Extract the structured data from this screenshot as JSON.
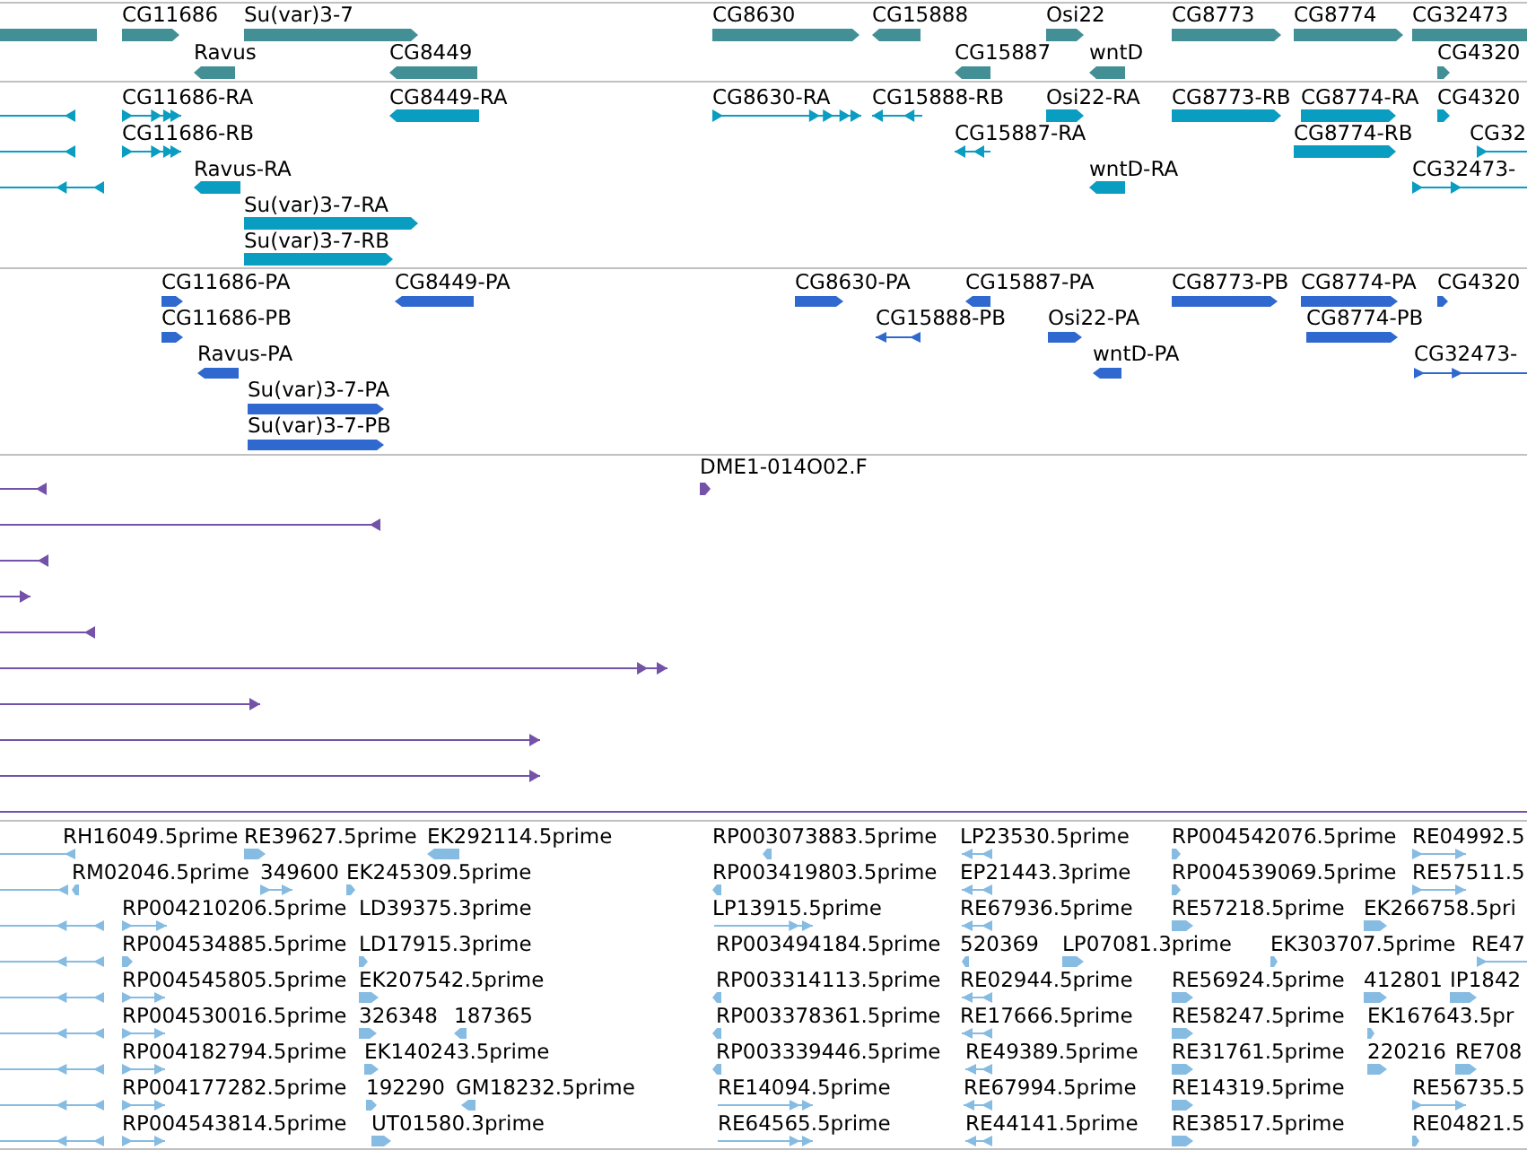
{
  "tracks": [
    {
      "color": "#428f96",
      "lanes": [
        {
          "features": [
            {
              "reverse": true
            },
            {
              "label": "CG11686",
              "reverse": false
            },
            {
              "label": "Su(var)3-7",
              "reverse": false
            },
            {
              "label": "CG8630",
              "reverse": false
            },
            {
              "label": "CG15888",
              "reverse": true
            },
            {
              "label": "Osi22",
              "reverse": false
            },
            {
              "label": "CG8773",
              "reverse": false
            },
            {
              "label": "CG8774",
              "reverse": false
            },
            {
              "label": "CG32473",
              "reverse": false
            }
          ]
        },
        {
          "features": [
            {
              "label": "Ravus",
              "reverse": true
            },
            {
              "label": "CG8449",
              "reverse": true
            },
            {
              "label": "CG15887",
              "reverse": true
            },
            {
              "label": "wntD",
              "reverse": true
            },
            {
              "label": "CG4320",
              "reverse": false
            }
          ]
        }
      ]
    },
    {
      "color": "#0a9dc2",
      "lanes": [
        {
          "features": [
            {
              "reverse": true
            },
            {
              "label": "CG11686-RA",
              "reverse": false
            },
            {
              "label": "CG8449-RA",
              "reverse": true
            },
            {
              "label": "CG8630-RA",
              "reverse": false
            },
            {
              "label": "CG15888-RB",
              "reverse": true
            },
            {
              "label": "Osi22-RA",
              "reverse": false
            },
            {
              "label": "CG8773-RB",
              "reverse": false
            },
            {
              "label": "CG8774-RA",
              "reverse": false
            },
            {
              "label": "CG4320",
              "reverse": false
            }
          ]
        },
        {
          "features": [
            {
              "reverse": true
            },
            {
              "label": "CG11686-RB",
              "reverse": false
            },
            {
              "label": "CG15887-RA",
              "reverse": true
            },
            {
              "label": "CG8774-RB",
              "reverse": false
            },
            {
              "label": "CG32",
              "reverse": false
            }
          ]
        },
        {
          "features": [
            {
              "reverse": true
            },
            {
              "label": "Ravus-RA",
              "reverse": true
            },
            {
              "label": "wntD-RA",
              "reverse": true
            },
            {
              "label": "CG32473-",
              "reverse": false
            }
          ]
        },
        {
          "features": [
            {
              "label": "Su(var)3-7-RA",
              "reverse": false
            }
          ]
        },
        {
          "features": [
            {
              "label": "Su(var)3-7-RB",
              "reverse": false
            }
          ]
        }
      ]
    },
    {
      "color": "#2f68cf",
      "lanes": [
        {
          "features": [
            {
              "label": "CG11686-PA",
              "reverse": false
            },
            {
              "label": "CG8449-PA",
              "reverse": true
            },
            {
              "label": "CG8630-PA",
              "reverse": false
            },
            {
              "label": "CG15887-PA",
              "reverse": true
            },
            {
              "label": "CG8773-PB",
              "reverse": false
            },
            {
              "label": "CG8774-PA",
              "reverse": false
            },
            {
              "label": "CG4320",
              "reverse": false
            }
          ]
        },
        {
          "features": [
            {
              "label": "CG11686-PB",
              "reverse": false
            },
            {
              "label": "CG15888-PB",
              "reverse": true
            },
            {
              "label": "Osi22-PA",
              "reverse": false
            },
            {
              "label": "CG8774-PB",
              "reverse": false
            }
          ]
        },
        {
          "features": [
            {
              "label": "Ravus-PA",
              "reverse": true
            },
            {
              "label": "wntD-PA",
              "reverse": true
            },
            {
              "label": "CG32473-",
              "reverse": false
            }
          ]
        },
        {
          "features": [
            {
              "label": "Su(var)3-7-PA",
              "reverse": false
            }
          ]
        },
        {
          "features": [
            {
              "label": "Su(var)3-7-PB",
              "reverse": false
            }
          ]
        }
      ]
    },
    {
      "color": "#7452a8",
      "lanes": [
        {
          "features": [
            {
              "reverse": true
            },
            {
              "label": "DME1-014O02.F",
              "reverse": false
            }
          ]
        },
        {
          "features": [
            {
              "reverse": true
            }
          ]
        },
        {
          "features": [
            {
              "reverse": true
            }
          ]
        },
        {
          "features": [
            {
              "reverse": false
            }
          ]
        },
        {
          "features": [
            {
              "reverse": true
            }
          ]
        },
        {
          "features": [
            {
              "reverse": false
            }
          ]
        },
        {
          "features": [
            {
              "reverse": false
            }
          ]
        },
        {
          "features": [
            {
              "reverse": false
            }
          ]
        },
        {
          "features": [
            {
              "reverse": false
            }
          ]
        }
      ]
    },
    {
      "color": "#86bbe2",
      "lanes": [
        {
          "features": [
            {
              "label": "RH16049.5prime",
              "reverse": true
            },
            {
              "label": "RE39627.5prime",
              "reverse": false
            },
            {
              "label": "EK292114.5prime",
              "reverse": true
            },
            {
              "label": "RP003073883.5prime",
              "reverse": true
            },
            {
              "label": "LP23530.5prime",
              "reverse": true
            },
            {
              "label": "RP004542076.5prime",
              "reverse": false
            },
            {
              "label": "RE04992.5",
              "reverse": false
            }
          ]
        },
        {
          "features": [
            {
              "reverse": true
            },
            {
              "label": "RM02046.5prime",
              "reverse": true
            },
            {
              "label": "349600",
              "reverse": false
            },
            {
              "label": "EK245309.5prime",
              "reverse": false
            },
            {
              "label": "RP003419803.5prime",
              "reverse": true
            },
            {
              "label": "EP21443.3prime",
              "reverse": true
            },
            {
              "label": "RP004539069.5prime",
              "reverse": false
            },
            {
              "label": "RE57511.5",
              "reverse": false
            }
          ]
        },
        {
          "features": [
            {
              "reverse": true
            },
            {
              "label": "RP004210206.5prime",
              "reverse": false
            },
            {
              "label": "LD39375.3prime"
            },
            {
              "label": "LP13915.5prime",
              "reverse": false
            },
            {
              "label": "RE67936.5prime",
              "reverse": true
            },
            {
              "label": "RE57218.5prime",
              "reverse": false
            },
            {
              "label": "EK266758.5pri",
              "reverse": false
            }
          ]
        },
        {
          "features": [
            {
              "reverse": true
            },
            {
              "label": "RP004534885.5prime",
              "reverse": false
            },
            {
              "label": "LD17915.3prime",
              "reverse": false
            },
            {
              "label": "RP003494184.5prime"
            },
            {
              "label": "520369",
              "reverse": true
            },
            {
              "label": "LP07081.3prime",
              "reverse": false
            },
            {
              "label": "EK303707.5prime",
              "reverse": false
            },
            {
              "label": "RE47",
              "reverse": false
            }
          ]
        },
        {
          "features": [
            {
              "reverse": true
            },
            {
              "label": "RP004545805.5prime",
              "reverse": false
            },
            {
              "label": "EK207542.5prime",
              "reverse": false
            },
            {
              "label": "RP003314113.5prime",
              "reverse": true
            },
            {
              "label": "RE02944.5prime",
              "reverse": true
            },
            {
              "label": "RE56924.5prime",
              "reverse": false
            },
            {
              "label": "412801",
              "reverse": false
            },
            {
              "label": "IP1842",
              "reverse": false
            }
          ]
        },
        {
          "features": [
            {
              "reverse": true
            },
            {
              "label": "RP004530016.5prime",
              "reverse": false
            },
            {
              "label": "326348",
              "reverse": false
            },
            {
              "label": "187365",
              "reverse": true
            },
            {
              "label": "RP003378361.5prime",
              "reverse": true
            },
            {
              "label": "RE17666.5prime",
              "reverse": true
            },
            {
              "label": "RE58247.5prime",
              "reverse": false
            },
            {
              "label": "EK167643.5pr",
              "reverse": false
            }
          ]
        },
        {
          "features": [
            {
              "reverse": true
            },
            {
              "label": "RP004182794.5prime",
              "reverse": false
            },
            {
              "label": "EK140243.5prime",
              "reverse": false
            },
            {
              "label": "RP003339446.5prime",
              "reverse": true
            },
            {
              "label": "RE49389.5prime",
              "reverse": true
            },
            {
              "label": "RE31761.5prime",
              "reverse": false
            },
            {
              "label": "220216",
              "reverse": false
            },
            {
              "label": "RE708",
              "reverse": false
            }
          ]
        },
        {
          "features": [
            {
              "reverse": true
            },
            {
              "label": "RP004177282.5prime",
              "reverse": false
            },
            {
              "label": "192290",
              "reverse": false
            },
            {
              "label": "GM18232.5prime",
              "reverse": true
            },
            {
              "label": "RE14094.5prime",
              "reverse": false
            },
            {
              "label": "RE67994.5prime",
              "reverse": true
            },
            {
              "label": "RE14319.5prime",
              "reverse": false
            },
            {
              "label": "RE56735.5",
              "reverse": false
            }
          ]
        },
        {
          "features": [
            {
              "reverse": true
            },
            {
              "label": "RP004543814.5prime",
              "reverse": false
            },
            {
              "label": "UT01580.3prime",
              "reverse": false
            },
            {
              "label": "RE64565.5prime",
              "reverse": false
            },
            {
              "label": "RE44141.5prime",
              "reverse": true
            },
            {
              "label": "RE38517.5prime",
              "reverse": false
            },
            {
              "label": "RE04821.5",
              "reverse": false
            }
          ]
        }
      ]
    }
  ]
}
